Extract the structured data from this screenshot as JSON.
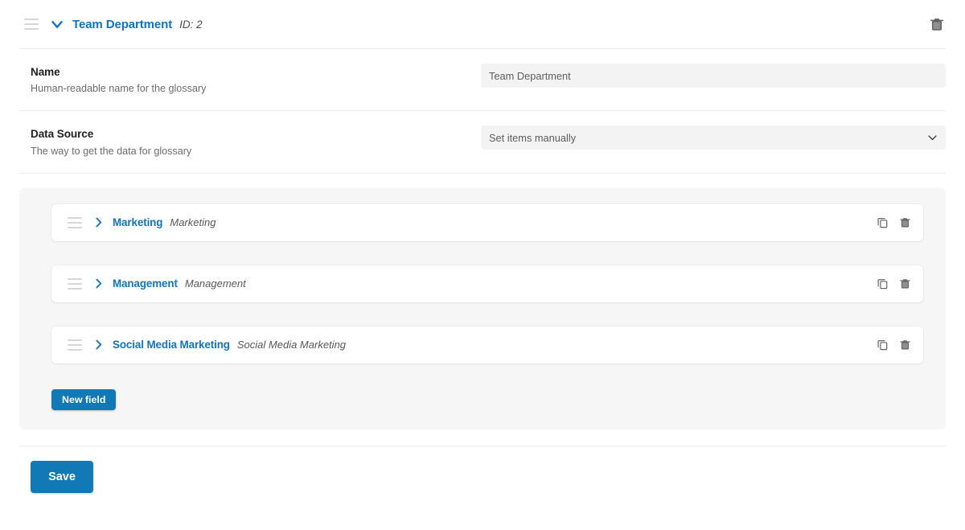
{
  "header": {
    "drag_handle_icon": "drag-handle-icon",
    "collapse_icon": "chevron-down-icon",
    "title": "Team Department",
    "id_label": "ID: 2",
    "delete_icon": "trash-icon"
  },
  "fields": [
    {
      "label": "Name",
      "description": "Human-readable name for the glossary",
      "control": "text",
      "value": "Team Department",
      "placeholder": "Team Department"
    },
    {
      "label": "Data Source",
      "description": "The way to get the data for glossary",
      "control": "select",
      "value": "Set items manually",
      "options": [
        "Set items manually"
      ]
    }
  ],
  "items": [
    {
      "drag_handle_icon": "drag-handle-icon",
      "expand_icon": "chevron-right-icon",
      "name": "Marketing",
      "alias": "Marketing",
      "copy_icon": "copy-icon",
      "delete_icon": "trash-icon"
    },
    {
      "drag_handle_icon": "drag-handle-icon",
      "expand_icon": "chevron-right-icon",
      "name": "Management",
      "alias": "Management",
      "copy_icon": "copy-icon",
      "delete_icon": "trash-icon"
    },
    {
      "drag_handle_icon": "drag-handle-icon",
      "expand_icon": "chevron-right-icon",
      "name": "Social Media Marketing",
      "alias": "Social Media Marketing",
      "copy_icon": "copy-icon",
      "delete_icon": "trash-icon"
    }
  ],
  "buttons": {
    "new_field": "New field",
    "save": "Save"
  },
  "colors": {
    "accent": "#1274ba",
    "button": "#1179b6",
    "panel_bg": "#f6f6f7",
    "input_bg": "#f3f3f4",
    "divider": "#ededee"
  }
}
